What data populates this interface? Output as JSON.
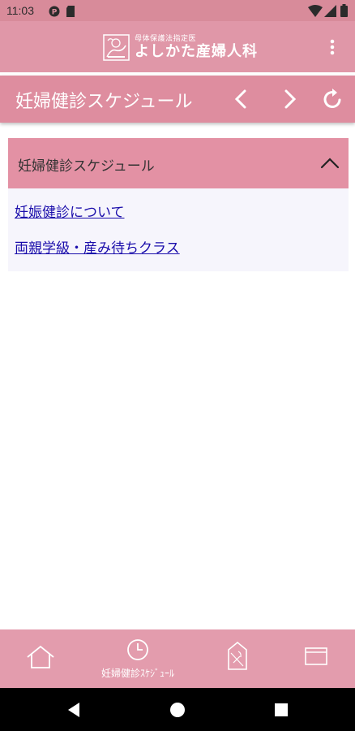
{
  "status": {
    "time": "11:03"
  },
  "app": {
    "logo_sub": "母体保護法指定医",
    "logo_main": "よしかた産婦人科"
  },
  "toolbar": {
    "title": "妊婦健診スケジュール"
  },
  "panel": {
    "title": "妊婦健診スケジュール",
    "links": [
      "妊娠健診について",
      "両親学級・産み待ちクラス"
    ]
  },
  "bottom_nav": {
    "items": [
      {
        "icon": "home-icon",
        "label": ""
      },
      {
        "icon": "clock-icon",
        "label": "妊婦健診ｽｹｼﾞｭｰﾙ"
      },
      {
        "icon": "map-icon",
        "label": ""
      },
      {
        "icon": "browser-icon",
        "label": ""
      }
    ]
  },
  "colors": {
    "status_bar": "#d88b9a",
    "app_bar": "#e097a8",
    "toolbar": "#de8d9f",
    "panel_header": "#e391a4",
    "bottom_nav": "#e39cad",
    "link": "#1a0dab"
  }
}
